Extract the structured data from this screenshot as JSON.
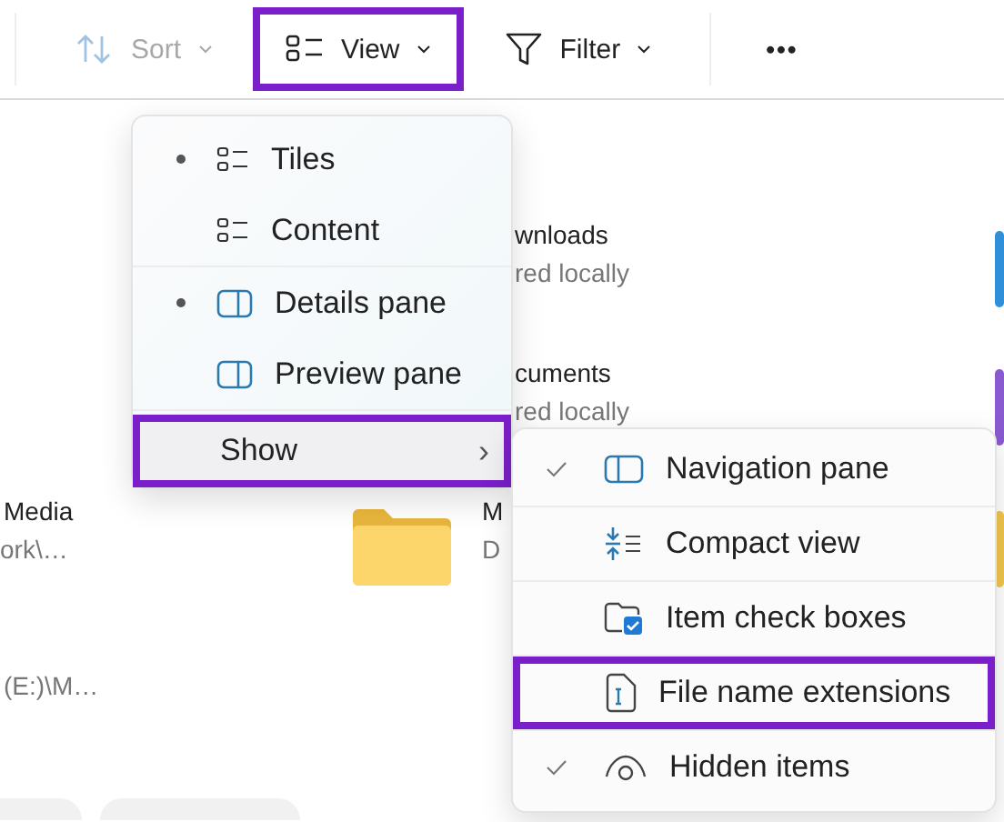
{
  "toolbar": {
    "buttons": [
      {
        "label": "Sort",
        "kind": "dropdown",
        "disabled": true,
        "highlighted": false
      },
      {
        "label": "View",
        "kind": "dropdown",
        "disabled": false,
        "highlighted": true
      },
      {
        "label": "Filter",
        "kind": "dropdown",
        "disabled": false,
        "highlighted": false
      },
      {
        "label": "•••",
        "kind": "more",
        "disabled": false,
        "highlighted": false
      }
    ]
  },
  "files": [
    {
      "name": "wnloads",
      "detail": "red locally"
    },
    {
      "name": "cuments",
      "detail": "red locally"
    },
    {
      "name": "Media",
      "detail": "ork\\…"
    },
    {
      "name": "M",
      "detail": "D"
    },
    {
      "name": "(E:)\\M…"
    }
  ],
  "view_menu": {
    "items": [
      {
        "label": "Tiles",
        "kind": "option",
        "selected": true,
        "highlighted": false
      },
      {
        "label": "Content",
        "kind": "option",
        "selected": false,
        "highlighted": false
      },
      {
        "label": "Details pane",
        "kind": "option",
        "selected": true,
        "highlighted": false
      },
      {
        "label": "Preview pane",
        "kind": "option",
        "selected": false,
        "highlighted": false
      },
      {
        "label": "Show",
        "kind": "submenu",
        "submenu_arrow": "›",
        "highlighted": true
      }
    ]
  },
  "show_menu": {
    "items": [
      {
        "label": "Navigation pane",
        "checked": true,
        "highlighted": false
      },
      {
        "label": "Compact view",
        "checked": false,
        "highlighted": false
      },
      {
        "label": "Item check boxes",
        "checked": false,
        "highlighted": false
      },
      {
        "label": "File name extensions",
        "checked": false,
        "highlighted": true
      },
      {
        "label": "Hidden items",
        "checked": true,
        "highlighted": false
      }
    ]
  }
}
